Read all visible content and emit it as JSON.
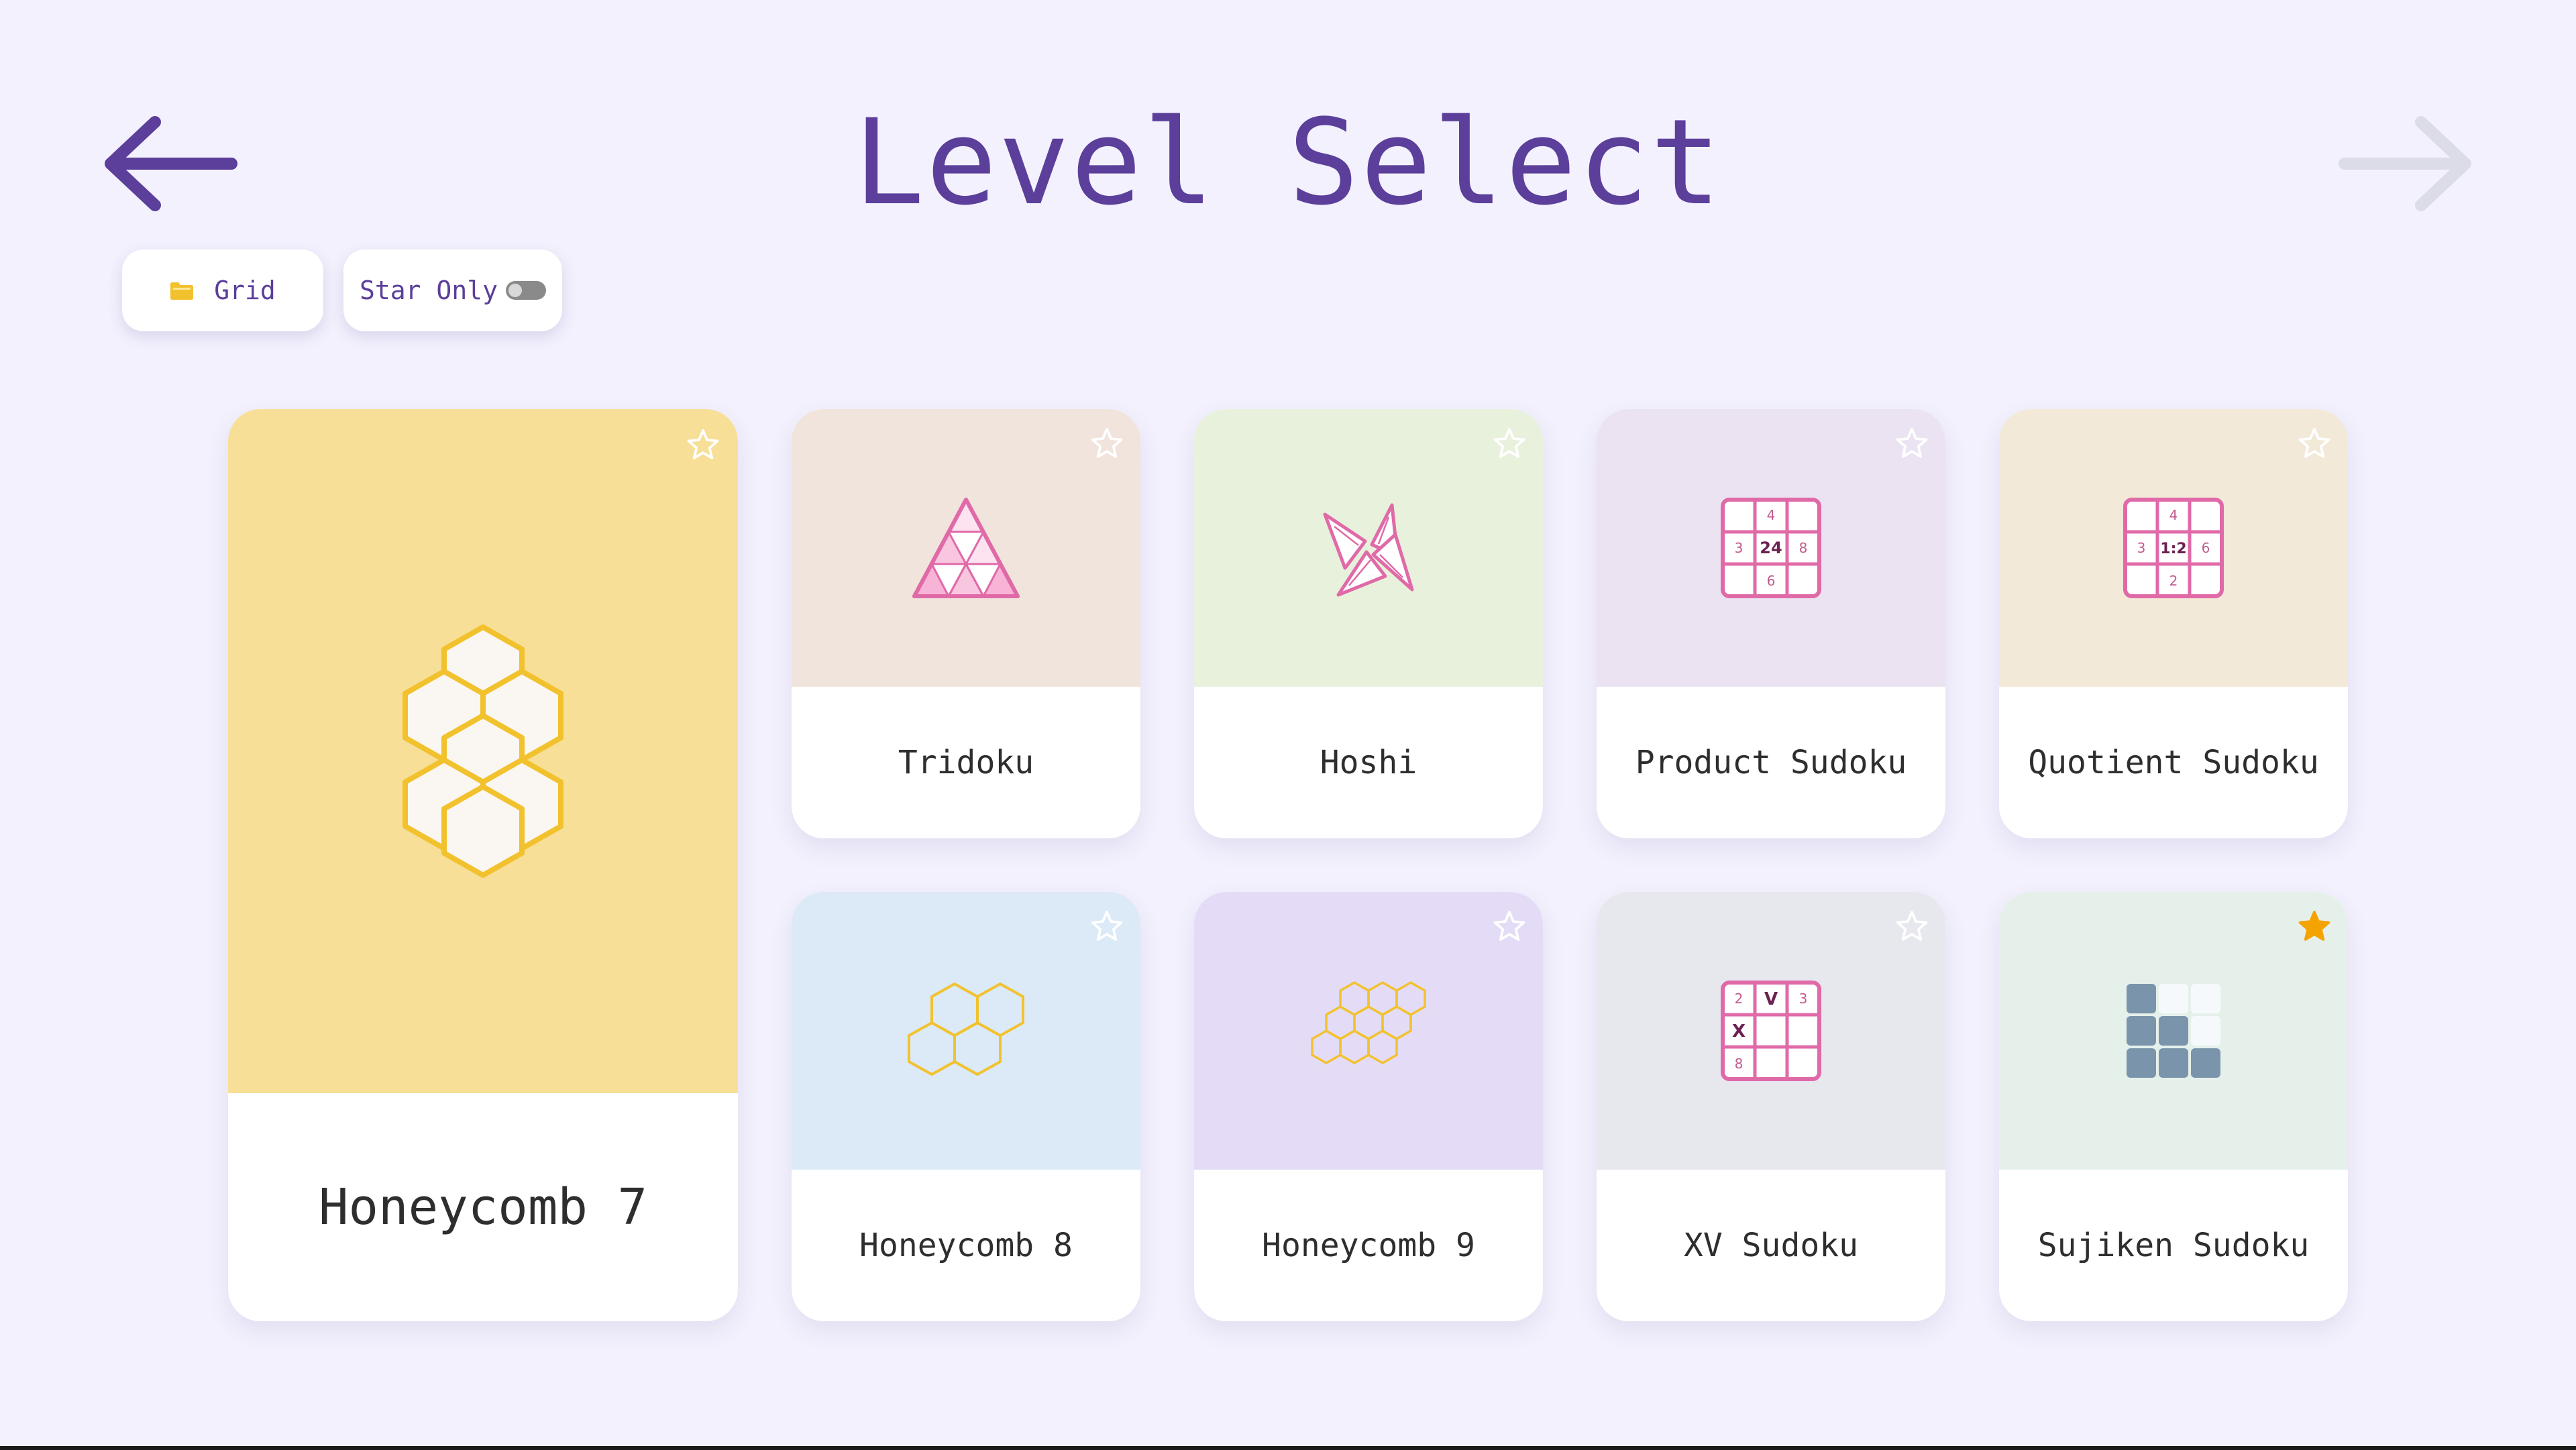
{
  "page": {
    "title": "Level Select"
  },
  "filters": {
    "grid_label": "Grid",
    "star_only_label": "Star Only",
    "star_only_enabled": false
  },
  "icons": {
    "back": "arrow-left-icon",
    "next": "arrow-right-icon",
    "grid": "folder-icon",
    "favorite": "star-icon"
  },
  "colors": {
    "accent": "#5b3f9a",
    "background": "#f3f1fd",
    "disabled_arrow": "#dcdbe8",
    "star_active": "#f5a300",
    "puzzle_pink": "#e06aa8",
    "honeycomb_gold": "#f2c22e"
  },
  "levels": [
    {
      "name": "Honeycomb 7",
      "starred": false,
      "bg": "#f7df98"
    },
    {
      "name": "Tridoku",
      "starred": false,
      "bg": "#f1e4dc"
    },
    {
      "name": "Hoshi",
      "starred": false,
      "bg": "#e8f1dc"
    },
    {
      "name": "Product Sudoku",
      "starred": false,
      "bg": "#ebe3f2",
      "clues": [
        "4",
        "3",
        "24",
        "8",
        "6"
      ]
    },
    {
      "name": "Quotient Sudoku",
      "starred": false,
      "bg": "#f2e9d8",
      "clues": [
        "4",
        "3",
        "1:2",
        "6",
        "2"
      ]
    },
    {
      "name": "Honeycomb 8",
      "starred": false,
      "bg": "#dce9f7"
    },
    {
      "name": "Honeycomb 9",
      "starred": false,
      "bg": "#e4dcf6"
    },
    {
      "name": "XV Sudoku",
      "starred": false,
      "bg": "#e7e7ee",
      "clues": [
        "2",
        "V",
        "3",
        "X",
        "8"
      ]
    },
    {
      "name": "Sujiken Sudoku",
      "starred": true,
      "bg": "#e6f0eb"
    }
  ]
}
